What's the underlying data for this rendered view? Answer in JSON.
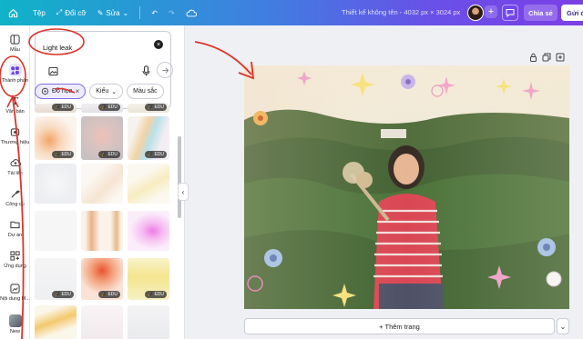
{
  "topbar": {
    "file_label": "Tệp",
    "resize_label": "Đổi cỡ",
    "edit_label": "Sửa",
    "title": "Thiết kế không tên - 4032 px × 3024 px",
    "share_label": "Chia sẻ",
    "send_label": "Gửi đ"
  },
  "rail": [
    {
      "label": "Mẫu",
      "icon": "template-icon"
    },
    {
      "label": "Thành phần",
      "icon": "elements-icon"
    },
    {
      "label": "Văn bản",
      "icon": "text-icon"
    },
    {
      "label": "Thương hiệu",
      "icon": "brand-icon"
    },
    {
      "label": "Tải lên",
      "icon": "upload-icon"
    },
    {
      "label": "Công cụ",
      "icon": "tools-icon"
    },
    {
      "label": "Dự án",
      "icon": "folder-icon"
    },
    {
      "label": "Ứng dụng",
      "icon": "apps-icon"
    },
    {
      "label": "Nội dung M...",
      "icon": "magic-media-icon"
    },
    {
      "label": "New",
      "icon": "new-icon"
    }
  ],
  "panel": {
    "search_value": "Light leak",
    "filters": [
      {
        "label": "Đồ họa",
        "active": true
      },
      {
        "label": "Kiểu",
        "active": false
      },
      {
        "label": "Màu sắc",
        "active": false
      }
    ],
    "edu_badge": "EDU"
  },
  "canvas": {
    "add_page_label": "+ Thêm trang"
  },
  "colors": {
    "accent": "#7d2ae8",
    "annotation": "#d9342b"
  }
}
